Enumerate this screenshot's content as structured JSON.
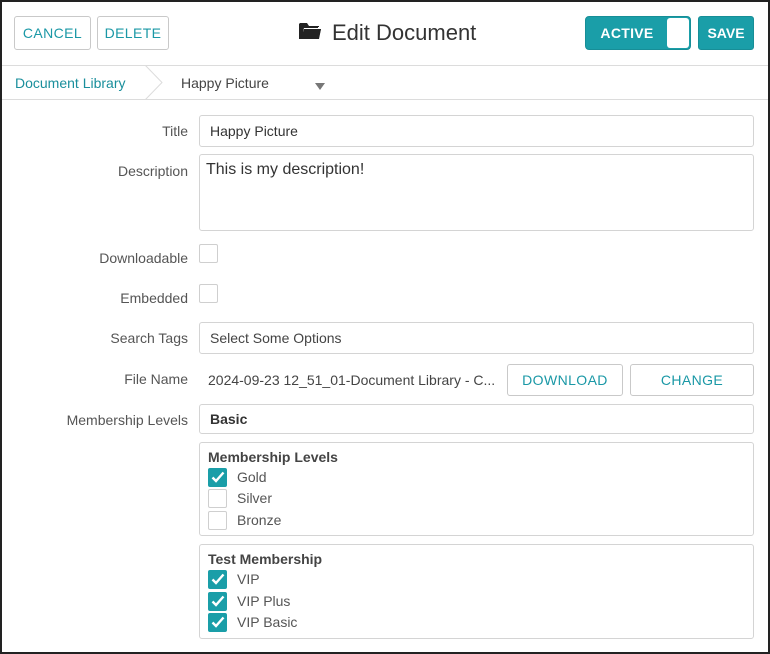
{
  "header": {
    "cancel_label": "CANCEL",
    "delete_label": "DELETE",
    "title": "Edit Document",
    "title_icon": "folder-open-icon",
    "status_label": "ACTIVE",
    "save_label": "SAVE",
    "accent_color": "#1a9ea8"
  },
  "breadcrumb": {
    "root": "Document Library",
    "current": "Happy Picture"
  },
  "form": {
    "title_label": "Title",
    "title_value": "Happy Picture",
    "description_label": "Description",
    "description_value": "This is my description!",
    "downloadable_label": "Downloadable",
    "downloadable_checked": false,
    "embedded_label": "Embedded",
    "embedded_checked": false,
    "search_tags_label": "Search Tags",
    "search_tags_placeholder": "Select Some Options",
    "file_name_label": "File Name",
    "file_name_value": "2024-09-23 12_51_01-Document Library - C...",
    "download_label": "DOWNLOAD",
    "change_label": "CHANGE",
    "membership_label": "Membership Levels",
    "membership_value": "Basic"
  },
  "groups": [
    {
      "title": "Membership Levels",
      "options": [
        {
          "label": "Gold",
          "checked": true
        },
        {
          "label": "Silver",
          "checked": false
        },
        {
          "label": "Bronze",
          "checked": false
        }
      ]
    },
    {
      "title": "Test Membership",
      "options": [
        {
          "label": "VIP",
          "checked": true
        },
        {
          "label": "VIP Plus",
          "checked": true
        },
        {
          "label": "VIP Basic",
          "checked": true
        }
      ]
    }
  ]
}
